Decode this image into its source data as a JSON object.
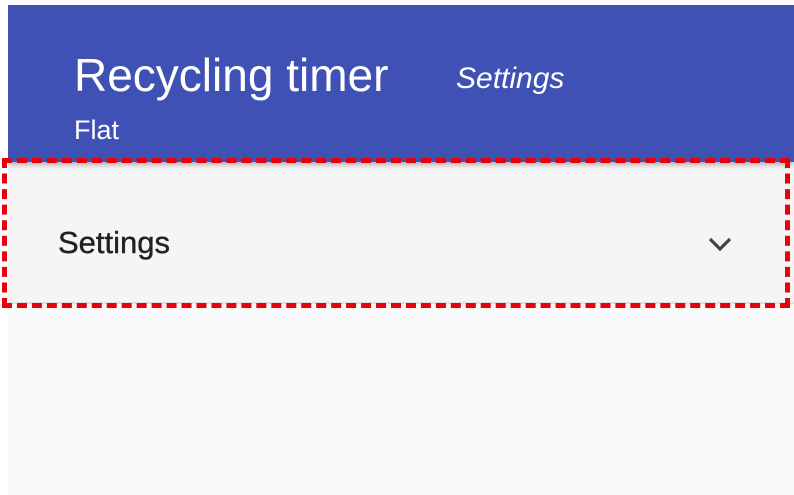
{
  "header": {
    "title": "Recycling timer",
    "section": "Settings",
    "subtitle": "Flat",
    "background_color": "#3f51b5"
  },
  "settings_panel": {
    "label": "Settings",
    "toggle_icon": "chevron-down-icon",
    "expanded": false
  },
  "highlight": {
    "color": "#e8000b",
    "style": "dashed"
  }
}
